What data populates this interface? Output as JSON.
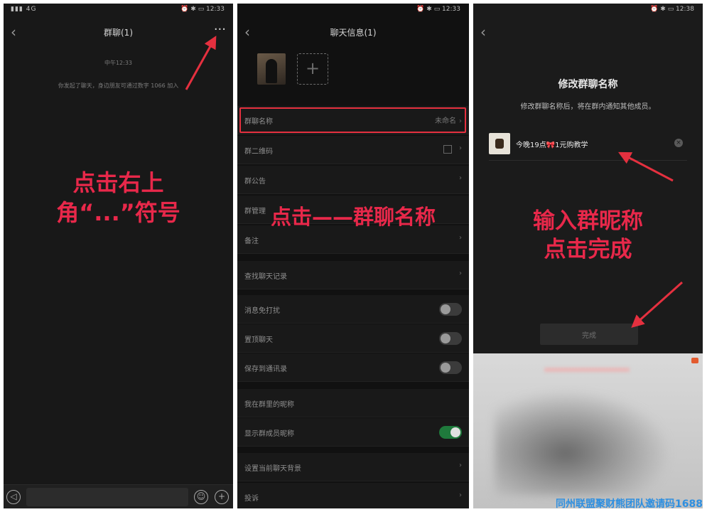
{
  "colors": {
    "accent_red": "#e5303f",
    "toggle_green": "#1f7a3c",
    "watermark_blue": "#2e8fe0"
  },
  "panel1": {
    "status_right": "⏰ ✱ ▭ 12:33",
    "status_left": "▮▮▮ 4G",
    "title": "群聊(1)",
    "more_label": "···",
    "time_label": "中午12:33",
    "system_message": "你发起了聊天，身边朋友可通过数字 1066 加入",
    "annotation_line1": "点击右上",
    "annotation_line2": "角“...”符号",
    "icons": {
      "voice": "voice-icon",
      "emoji": "emoji-icon",
      "plus": "plus-icon"
    }
  },
  "panel2": {
    "status_right": "⏰ ✱ ▭ 12:33",
    "title": "聊天信息(1)",
    "add_label": "+",
    "rows": [
      {
        "label": "群聊名称",
        "value": "未命名"
      },
      {
        "label": "群二维码"
      },
      {
        "label": "群公告"
      },
      {
        "label": "群管理"
      },
      {
        "label": "备注"
      },
      {
        "label": "查找聊天记录"
      },
      {
        "label": "消息免打扰",
        "toggle": false
      },
      {
        "label": "置顶聊天",
        "toggle": false
      },
      {
        "label": "保存到通讯录",
        "toggle": false
      },
      {
        "label": "我在群里的昵称"
      },
      {
        "label": "显示群成员昵称",
        "toggle": true
      },
      {
        "label": "设置当前聊天背景"
      },
      {
        "label": "投诉"
      }
    ],
    "annotation": "点击——群聊名称"
  },
  "panel3": {
    "status_right": "⏰ ✱ ▭ 12:38",
    "title": "修改群聊名称",
    "subtitle": "修改群聊名称后，将在群内通知其他成员。",
    "name_value": "今晚19点🎀1元购教学",
    "clear_label": "×",
    "done_label": "完成",
    "annotation_line1": "输入群昵称",
    "annotation_line2": "点击完成"
  },
  "watermark": "同州联盟聚财熊团队邀请码1688"
}
